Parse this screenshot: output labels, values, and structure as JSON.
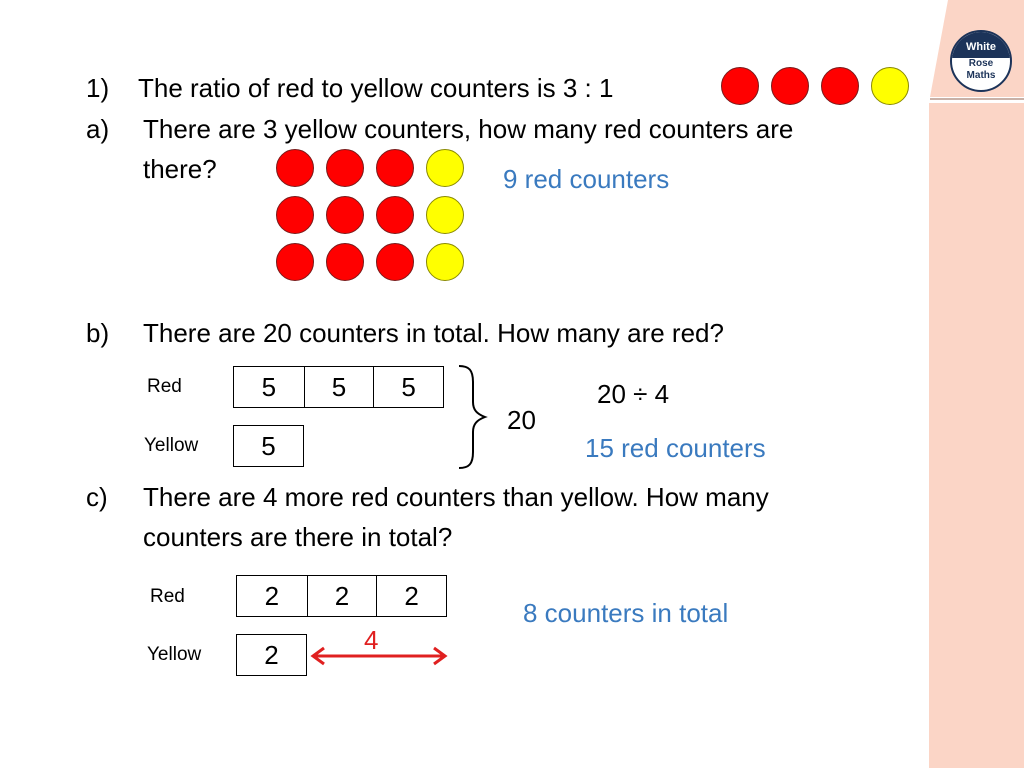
{
  "brand": {
    "logo_line1": "White",
    "logo_line2": "Rose",
    "logo_line3": "Maths",
    "panel_color": "#fbd5c6",
    "logo_color": "#1c3359"
  },
  "colors": {
    "answer": "#3a7abf",
    "red_counter": "#ff0000",
    "yellow_counter": "#ffff00",
    "arrow": "#e02020"
  },
  "question1": {
    "number": "1)",
    "text": "The ratio of red to yellow counters is 3 : 1",
    "ratio_counters": [
      "red",
      "red",
      "red",
      "yellow"
    ]
  },
  "part_a": {
    "label": "a)",
    "line1": "There are 3 yellow counters, how many red counters are",
    "line2": "there?",
    "grid_rows": [
      [
        "red",
        "red",
        "red",
        "yellow"
      ],
      [
        "red",
        "red",
        "red",
        "yellow"
      ],
      [
        "red",
        "red",
        "red",
        "yellow"
      ]
    ],
    "answer": "9 red counters"
  },
  "part_b": {
    "label": "b)",
    "text": "There are 20 counters in total. How many are red?",
    "red_label": "Red",
    "yellow_label": "Yellow",
    "red_cells": [
      "5",
      "5",
      "5"
    ],
    "yellow_cells": [
      "5"
    ],
    "total": "20",
    "working": "20 ÷ 4",
    "answer": "15 red counters"
  },
  "part_c": {
    "label": "c)",
    "line1": "There are 4 more red counters than yellow. How many",
    "line2": "counters are there in total?",
    "red_label": "Red",
    "yellow_label": "Yellow",
    "red_cells": [
      "2",
      "2",
      "2"
    ],
    "yellow_cells": [
      "2"
    ],
    "difference": "4",
    "answer": "8 counters in total"
  }
}
